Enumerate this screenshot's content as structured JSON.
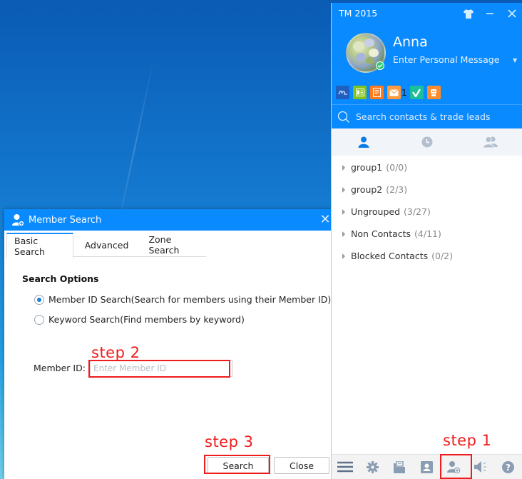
{
  "desktop": {
    "background": "blue-gradient"
  },
  "member_search_dialog": {
    "title": "Member Search",
    "title_icon": "add-user-icon",
    "close_icon": "close-icon",
    "tabs": [
      {
        "label": "Basic Search",
        "active": true
      },
      {
        "label": "Advanced",
        "active": false
      },
      {
        "label": "Zone Search",
        "active": false
      }
    ],
    "section_title": "Search Options",
    "options": [
      {
        "label": "Member ID Search(Search for members using their Member ID)",
        "checked": true
      },
      {
        "label": "Keyword Search(Find members by keyword)",
        "checked": false
      }
    ],
    "member_id": {
      "label": "Member ID:",
      "placeholder": "Enter Member ID",
      "value": ""
    },
    "buttons": {
      "search": "Search",
      "close": "Close"
    }
  },
  "tm_window": {
    "title": "TM 2015",
    "controls": {
      "skin": "tshirt-icon",
      "minimize": "minimize-icon",
      "close": "close-icon"
    },
    "user": {
      "name": "Anna",
      "personal_message": "Enter Personal Message",
      "status": "online"
    },
    "apps": [
      {
        "name": "alibaba-icon",
        "color": "#1f5fbf"
      },
      {
        "name": "news-icon",
        "color": "#7fc31c"
      },
      {
        "name": "notes-icon",
        "color": "#ff7a1a"
      },
      {
        "name": "mail-icon",
        "color": "#ff9a3c",
        "badge": "1"
      },
      {
        "name": "check-icon",
        "color": "#1dbf9a"
      },
      {
        "name": "robot-icon",
        "color": "#ff8c2a"
      }
    ],
    "search_placeholder": "Search contacts &  trade leads",
    "contact_tabs": [
      {
        "name": "contacts-tab",
        "icon": "person-icon",
        "active": true
      },
      {
        "name": "recent-tab",
        "icon": "clock-icon",
        "active": false
      },
      {
        "name": "groups-tab",
        "icon": "people-icon",
        "active": false
      }
    ],
    "groups": [
      {
        "name": "group1",
        "count": "(0/0)"
      },
      {
        "name": "group2",
        "count": "(2/3)"
      },
      {
        "name": "Ungrouped",
        "count": "(3/27)"
      },
      {
        "name": "Non Contacts",
        "count": "(4/11)"
      },
      {
        "name": "Blocked Contacts",
        "count": "(0/2)"
      }
    ],
    "footer_icons": [
      "menu-icon",
      "gear-icon",
      "inbox-icon",
      "contact-card-icon",
      "add-contact-icon",
      "speaker-icon",
      "help-icon"
    ]
  },
  "annotations": {
    "step1": "step 1",
    "step2": "step 2",
    "step3": "step 3",
    "color": "#ee1c1c"
  },
  "colors": {
    "accent": "#0a8aff",
    "tab_active": "#1a8cff",
    "icon_inactive": "#b3bfcf"
  }
}
